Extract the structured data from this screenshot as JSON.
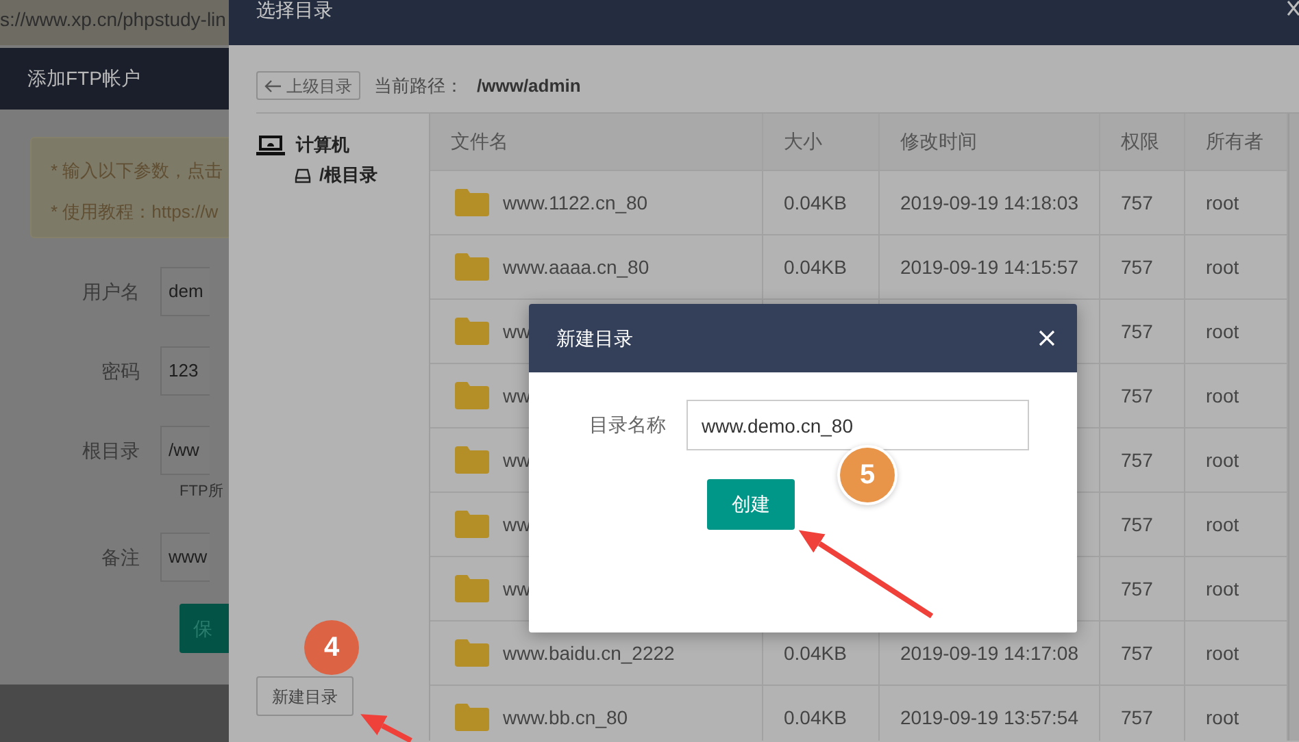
{
  "browser": {
    "url": "s://www.xp.cn/phpstudy-lin"
  },
  "background_panel": {
    "title": "添加FTP帐户",
    "notices": [
      "* 输入以下参数，点击",
      "* 使用教程：https://w"
    ],
    "fields": [
      {
        "label": "用户名",
        "value": "dem"
      },
      {
        "label": "密码",
        "value": "123"
      },
      {
        "label": "根目录",
        "value": "/ww",
        "hint": "FTP所"
      },
      {
        "label": "备注",
        "value": "www"
      }
    ],
    "save_button": "保"
  },
  "directory_dialog": {
    "title": "选择目录",
    "up_button": "上级目录",
    "path_label": "当前路径：",
    "path": "/www/admin",
    "tree": [
      {
        "label": "计算机",
        "kind": "computer",
        "children": [
          {
            "label": "/根目录",
            "kind": "drive"
          }
        ]
      }
    ],
    "new_folder_button": "新建目录",
    "table": {
      "columns": [
        "文件名",
        "大小",
        "修改时间",
        "权限",
        "所有者"
      ],
      "rows": [
        {
          "name": "www.1122.cn_80",
          "size": "0.04KB",
          "modified": "2019-09-19 14:18:03",
          "permission": "757",
          "owner": "root"
        },
        {
          "name": "www.aaaa.cn_80",
          "size": "0.04KB",
          "modified": "2019-09-19 14:15:57",
          "permission": "757",
          "owner": "root"
        },
        {
          "name": "ww",
          "permission": "757",
          "owner": "root"
        },
        {
          "name": "ww",
          "permission": "757",
          "owner": "root"
        },
        {
          "name": "ww",
          "permission": "757",
          "owner": "root"
        },
        {
          "name": "ww",
          "permission": "757",
          "owner": "root"
        },
        {
          "name": "ww",
          "permission": "757",
          "owner": "root"
        },
        {
          "name": "www.baidu.cn_2222",
          "size": "0.04KB",
          "modified": "2019-09-19 14:17:08",
          "permission": "757",
          "owner": "root"
        },
        {
          "name": "www.bb.cn_80",
          "size": "0.04KB",
          "modified": "2019-09-19 13:57:54",
          "permission": "757",
          "owner": "root"
        }
      ]
    }
  },
  "new_folder_dialog": {
    "title": "新建目录",
    "label": "目录名称",
    "value": "www.demo.cn_80",
    "create_button": "创建"
  },
  "annotations": [
    {
      "label": "4",
      "color": "#dc6444"
    },
    {
      "label": "5",
      "color": "#e8954a"
    }
  ]
}
